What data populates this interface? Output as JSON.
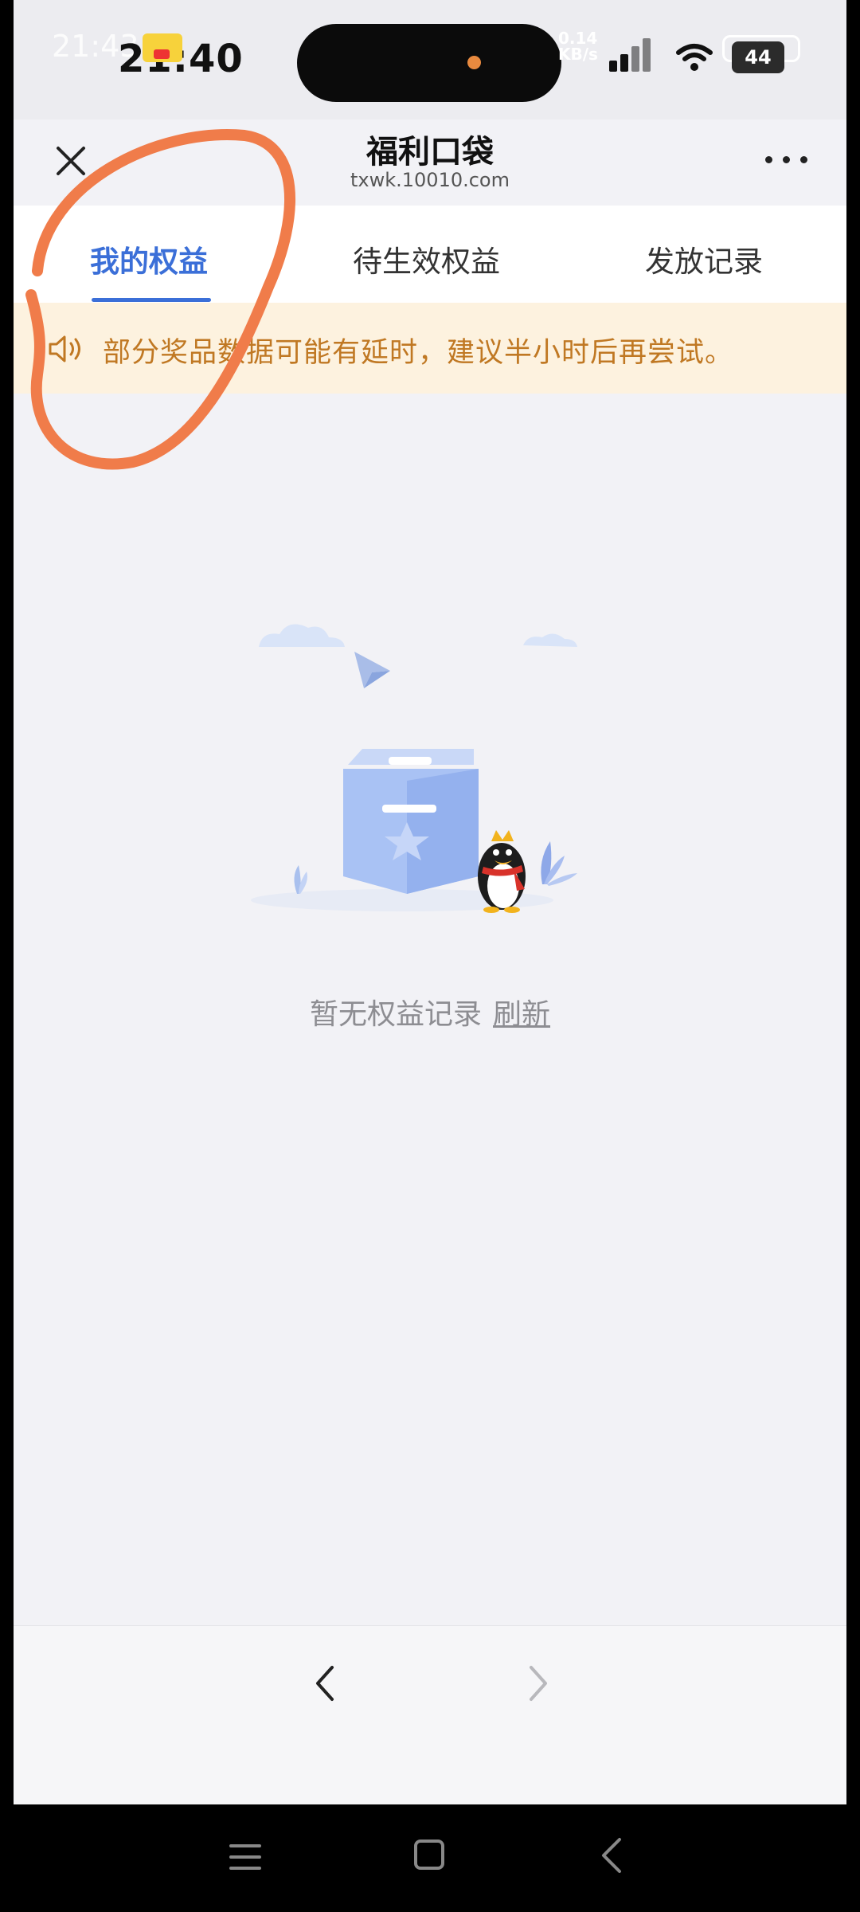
{
  "status_bar": {
    "ghost_time": "21:43",
    "time": "21:40",
    "net_speed": "0.14\nKB/s",
    "battery_outline": "45",
    "battery_level": "44"
  },
  "header": {
    "title": "福利口袋",
    "url": "txwk.10010.com"
  },
  "tabs": [
    {
      "label": "我的权益",
      "active": true
    },
    {
      "label": "待生效权益",
      "active": false
    },
    {
      "label": "发放记录",
      "active": false
    }
  ],
  "notice": {
    "text": "部分奖品数据可能有延时，建议半小时后再尝试。"
  },
  "empty_state": {
    "message": "暂无权益记录",
    "refresh_label": "刷新"
  },
  "colors": {
    "accent": "#3b6fd8",
    "notice_text": "#c07823",
    "notice_bg": "#fdf2df",
    "annotation": "#f07c4a"
  }
}
